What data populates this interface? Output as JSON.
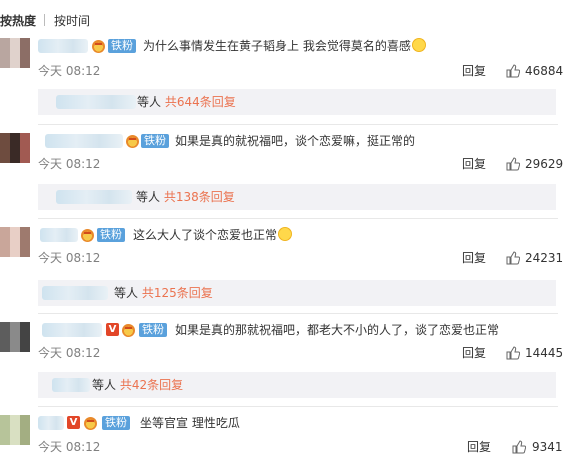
{
  "sort": {
    "hot": "按热度",
    "time": "按时间"
  },
  "fan_label": "铁粉",
  "reply_label": "回复",
  "comments": [
    {
      "text": "为什么事情发生在黄子韬身上 我会觉得莫名的喜感",
      "time": "今天 08:12",
      "likes": "46884",
      "sub_people": "等人",
      "sub_total": "共644条回复"
    },
    {
      "text": "如果是真的就祝福吧，谈个恋爱嘛，挺正常的",
      "time": "今天 08:12",
      "likes": "29629",
      "sub_people": "等人",
      "sub_total": "共138条回复"
    },
    {
      "text": "这么大人了谈个恋爱也正常",
      "time": "今天 08:12",
      "likes": "24231",
      "sub_people": "等人",
      "sub_total": "共125条回复"
    },
    {
      "text": "如果是真的那就祝福吧，都老大不小的人了，谈了恋爱也正常",
      "time": "今天 08:12",
      "likes": "14445",
      "sub_people": "等人",
      "sub_total": "共42条回复"
    },
    {
      "text": "坐等官宣  理性吃瓜",
      "time": "今天 08:12",
      "likes": "9341"
    }
  ],
  "colors": {
    "fan_badge": "#5aa1dc",
    "link": "#eb7350",
    "time": "#808080",
    "subbox": "#f2f2f5"
  }
}
